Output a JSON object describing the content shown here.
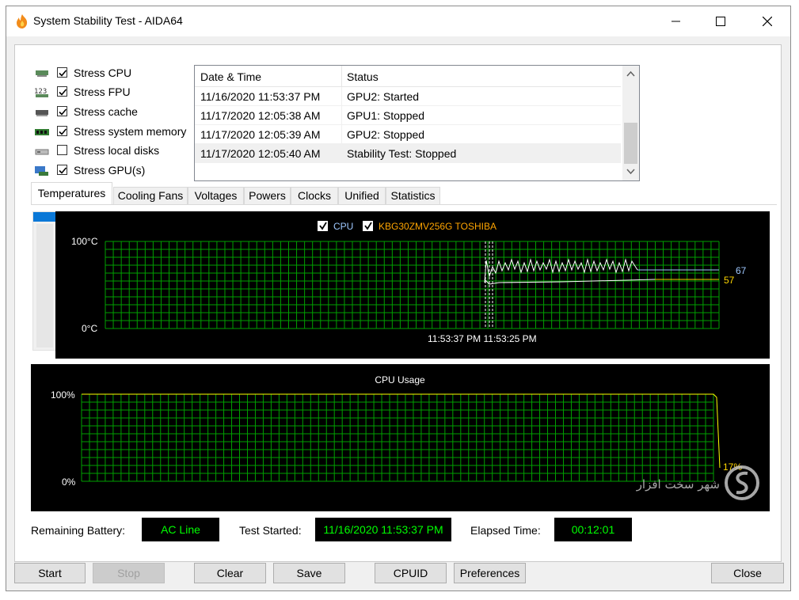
{
  "window": {
    "title": "System Stability Test - AIDA64"
  },
  "stress_options": [
    {
      "label": "Stress CPU",
      "checked": true,
      "icon": "cpu-chip-icon"
    },
    {
      "label": "Stress FPU",
      "checked": true,
      "icon": "fpu-123-icon"
    },
    {
      "label": "Stress cache",
      "checked": true,
      "icon": "cache-chip-icon"
    },
    {
      "label": "Stress system memory",
      "checked": true,
      "icon": "memory-module-icon"
    },
    {
      "label": "Stress local disks",
      "checked": false,
      "icon": "disk-drive-icon"
    },
    {
      "label": "Stress GPU(s)",
      "checked": true,
      "icon": "gpu-monitor-icon"
    }
  ],
  "log": {
    "headers": {
      "datetime": "Date & Time",
      "status": "Status"
    },
    "rows": [
      {
        "datetime": "11/16/2020 11:53:37 PM",
        "status": "GPU2: Started"
      },
      {
        "datetime": "11/17/2020 12:05:38 AM",
        "status": "GPU1: Stopped"
      },
      {
        "datetime": "11/17/2020 12:05:39 AM",
        "status": "GPU2: Stopped"
      },
      {
        "datetime": "11/17/2020 12:05:40 AM",
        "status": "Stability Test: Stopped"
      }
    ]
  },
  "tabs": [
    "Temperatures",
    "Cooling Fans",
    "Voltages",
    "Powers",
    "Clocks",
    "Unified",
    "Statistics"
  ],
  "active_tab": "Temperatures",
  "temperature_graph": {
    "legend": [
      {
        "label": "CPU",
        "checked": true,
        "color": "#ffffff"
      },
      {
        "label": "KBG30ZMV256G TOSHIBA",
        "checked": true,
        "color": "#ffa500"
      }
    ],
    "y_max_label": "100°C",
    "y_min_label": "0°C",
    "time_label": "11:53:37 PM 11:53:25 PM",
    "current_values": {
      "cpu": "67",
      "disk": "57"
    },
    "value_colors": {
      "cpu": "#9ec8ff",
      "disk": "#ffd700"
    }
  },
  "cpu_usage_graph": {
    "title": "CPU Usage",
    "y_max_label": "100%",
    "y_min_label": "0%",
    "current_value": "17%",
    "line_color": "#ffff00"
  },
  "status": {
    "battery_label": "Remaining Battery:",
    "battery_value": "AC Line",
    "started_label": "Test Started:",
    "started_value": "11/16/2020 11:53:37 PM",
    "elapsed_label": "Elapsed Time:",
    "elapsed_value": "00:12:01"
  },
  "buttons": {
    "start": "Start",
    "stop": "Stop",
    "clear": "Clear",
    "save": "Save",
    "cpuid": "CPUID",
    "preferences": "Preferences",
    "close": "Close"
  },
  "colors": {
    "grid": "#00a000",
    "graph_bg": "#000000",
    "status_value": "#00ff00",
    "accent": "#0a78d7"
  }
}
